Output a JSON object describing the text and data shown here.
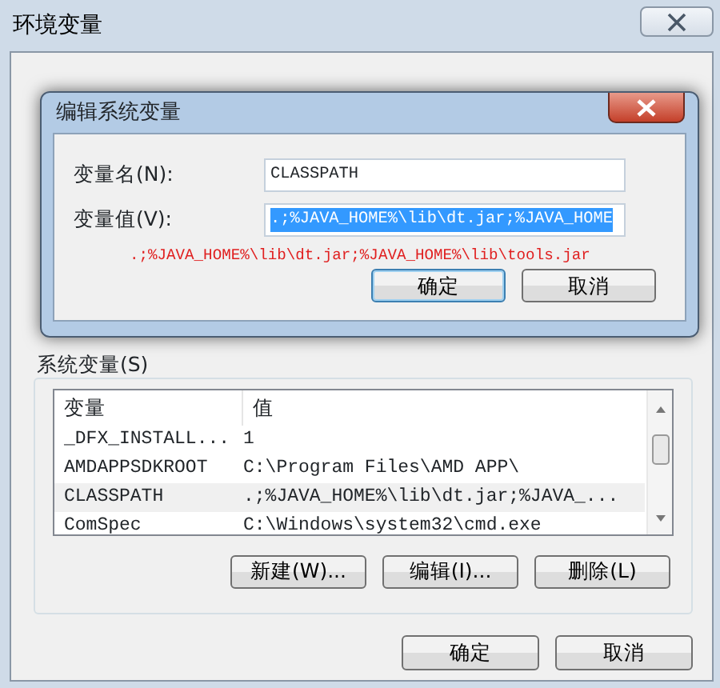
{
  "window": {
    "title": "环境变量"
  },
  "dialog": {
    "title": "编辑系统变量",
    "fields": [
      {
        "label": "变量名(N):",
        "value": "CLASSPATH",
        "selected": false
      },
      {
        "label": "变量值(V):",
        "value": ".;%JAVA_HOME%\\lib\\dt.jar;%JAVA_HOME",
        "selected": true
      }
    ],
    "note": ".;%JAVA_HOME%\\lib\\dt.jar;%JAVA_HOME%\\lib\\tools.jar",
    "buttons": [
      {
        "label": "确定",
        "default": true
      },
      {
        "label": "取消",
        "default": false
      }
    ]
  },
  "system_variables": {
    "label": "系统变量(S)",
    "columns": [
      "变量",
      "值"
    ],
    "rows": [
      {
        "name": "_DFX_INSTALL...",
        "value": "1",
        "selected": false
      },
      {
        "name": "AMDAPPSDKROOT",
        "value": "C:\\Program Files\\AMD APP\\",
        "selected": false
      },
      {
        "name": "CLASSPATH",
        "value": ".;%JAVA_HOME%\\lib\\dt.jar;%JAVA_...",
        "selected": true
      },
      {
        "name": "ComSpec",
        "value": "C:\\Windows\\system32\\cmd.exe",
        "selected": false
      }
    ],
    "buttons": [
      "新建(W)...",
      "编辑(I)...",
      "删除(L)"
    ]
  },
  "buttons": [
    "确定",
    "取消"
  ]
}
